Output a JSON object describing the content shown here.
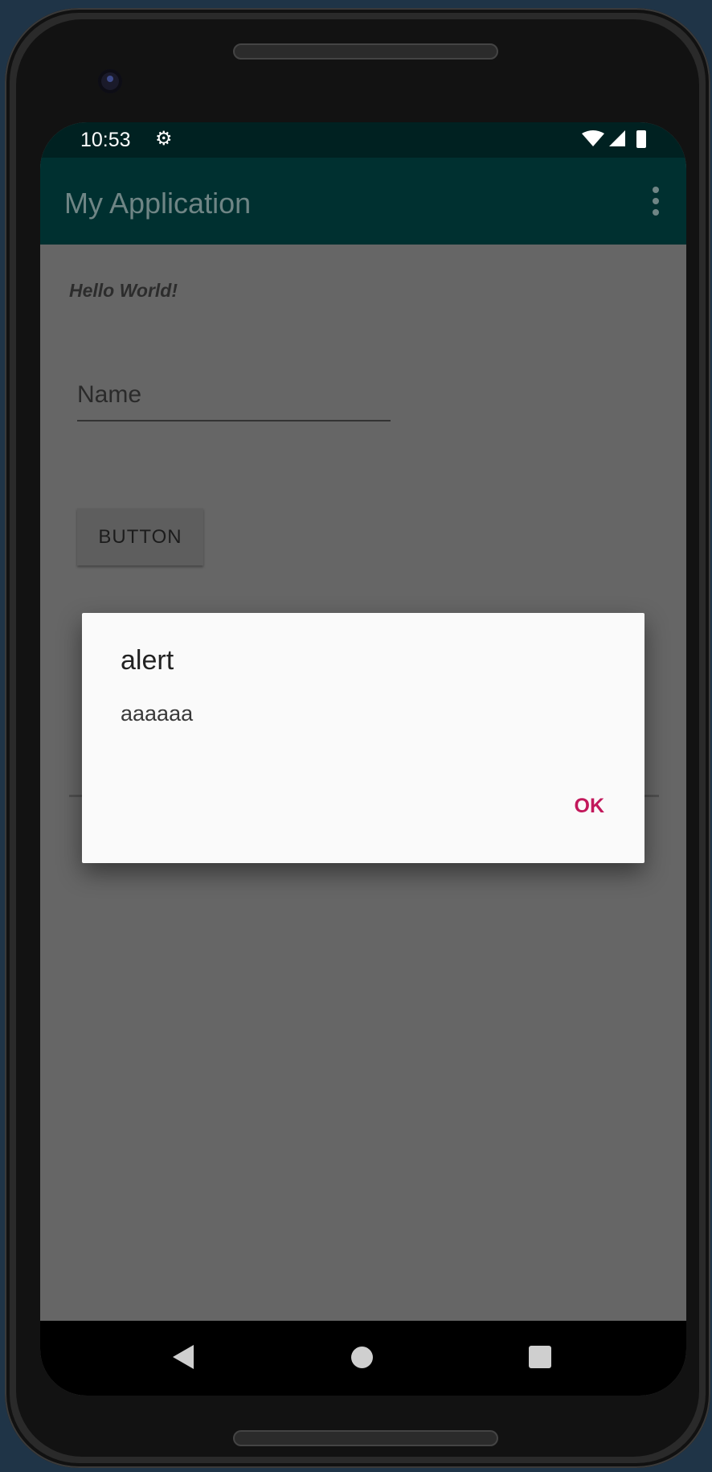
{
  "status_bar": {
    "time": "10:53",
    "settings_icon": "gear-icon",
    "wifi_icon": "wifi-icon",
    "signal_icon": "signal-icon",
    "battery_icon": "battery-icon"
  },
  "app_bar": {
    "title": "My Application",
    "overflow_icon": "more-vert-icon"
  },
  "content": {
    "hello_text": "Hello World!",
    "name_placeholder": "Name",
    "button_label": "BUTTON"
  },
  "dialog": {
    "title": "alert",
    "message": "aaaaaa",
    "ok_label": "OK"
  },
  "nav_bar": {
    "back_icon": "back-triangle-icon",
    "home_icon": "home-circle-icon",
    "recents_icon": "recents-square-icon"
  },
  "colors": {
    "status_bar": "#002121",
    "app_bar": "#003030",
    "dim_background": "#666666",
    "dialog_background": "#fafafa",
    "accent": "#c2185b"
  }
}
